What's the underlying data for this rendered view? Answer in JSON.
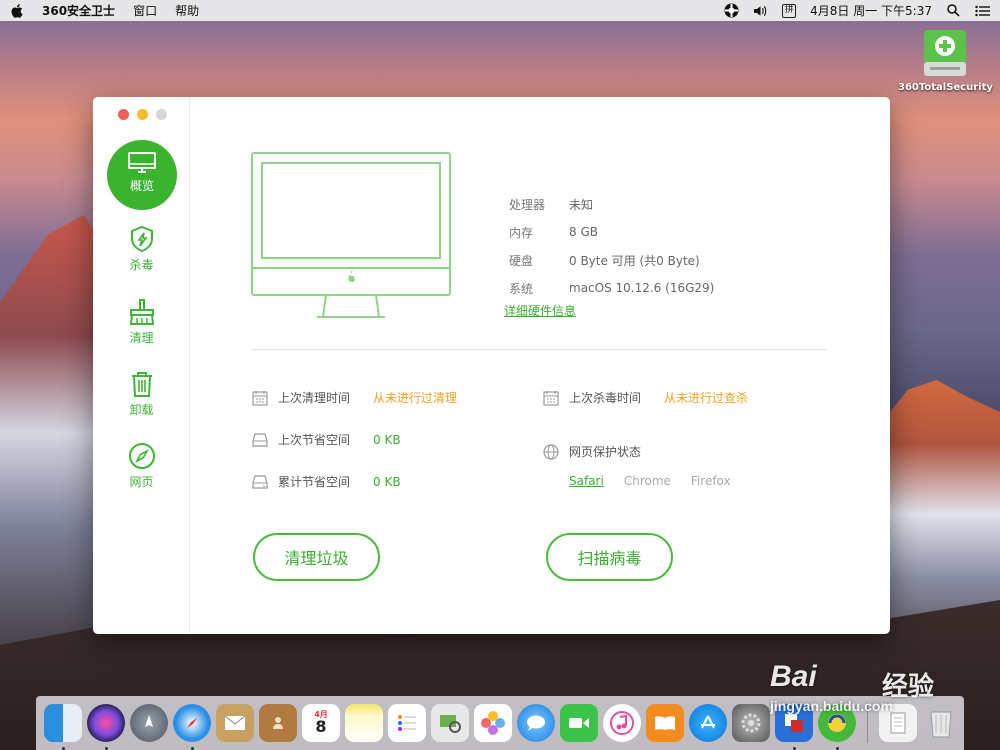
{
  "menubar": {
    "app_name": "360安全卫士",
    "items": [
      "窗口",
      "帮助"
    ],
    "input_method": "拼",
    "datetime": "4月8日 周一 下午5:37"
  },
  "desktop": {
    "drive_label": "360TotalSecurity"
  },
  "sidebar": {
    "items": [
      {
        "label": "概览",
        "icon": "monitor-icon",
        "active": true
      },
      {
        "label": "杀毒",
        "icon": "shield-icon",
        "active": false
      },
      {
        "label": "清理",
        "icon": "broom-icon",
        "active": false
      },
      {
        "label": "卸载",
        "icon": "trash-icon",
        "active": false
      },
      {
        "label": "网页",
        "icon": "compass-icon",
        "active": false
      }
    ]
  },
  "specs": {
    "processor_label": "处理器",
    "processor_value": "未知",
    "memory_label": "内存",
    "memory_value": "8 GB",
    "disk_label": "硬盘",
    "disk_value": "0 Byte 可用 (共0 Byte)",
    "system_label": "系统",
    "system_value": "macOS 10.12.6 (16G29)",
    "hardware_link": "详细硬件信息"
  },
  "stats": {
    "last_clean_label": "上次清理时间",
    "last_clean_value": "从未进行过清理",
    "last_saved_label": "上次节省空间",
    "last_saved_value": "0 KB",
    "total_saved_label": "累计节省空间",
    "total_saved_value": "0 KB",
    "last_scan_label": "上次杀毒时间",
    "last_scan_value": "从未进行过查杀",
    "web_protect_label": "网页保护状态",
    "browsers": [
      "Safari",
      "Chrome",
      "Firefox"
    ]
  },
  "buttons": {
    "clean": "清理垃圾",
    "scan": "扫描病毒"
  },
  "dock": {
    "calendar_month": "4月",
    "calendar_day": "8"
  },
  "watermark": {
    "brand": "Bai",
    "brand_cn": "经验",
    "url": "jingyan.baidu.com"
  },
  "colors": {
    "accent_green": "#3ab42f",
    "warning_orange": "#f0a020"
  }
}
